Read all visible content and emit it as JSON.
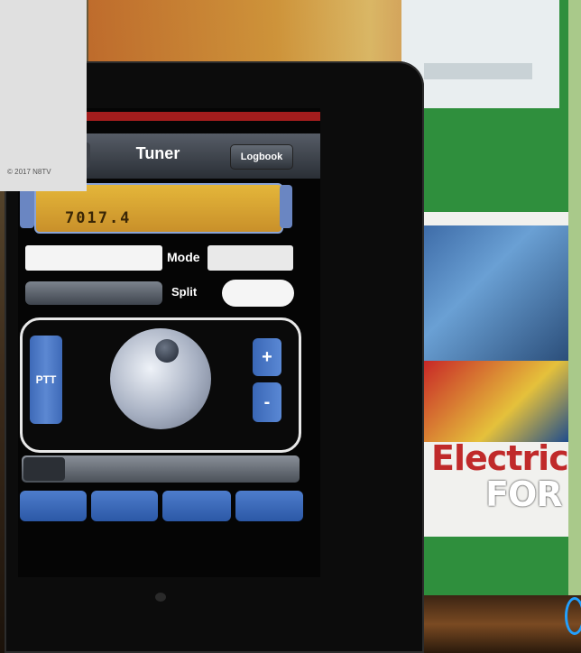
{
  "watermark": "© 2017 N8TV",
  "app": {
    "title": "Tuner",
    "logbook_label": "Logbook"
  },
  "frequency": {
    "value": "7017.4"
  },
  "mode_label": "Mode",
  "split_label": "Split",
  "buttons": {
    "ptt": "PTT",
    "plus": "+",
    "minus": "-"
  },
  "poster": {
    "line1": "Electric",
    "line2": "FOR"
  }
}
